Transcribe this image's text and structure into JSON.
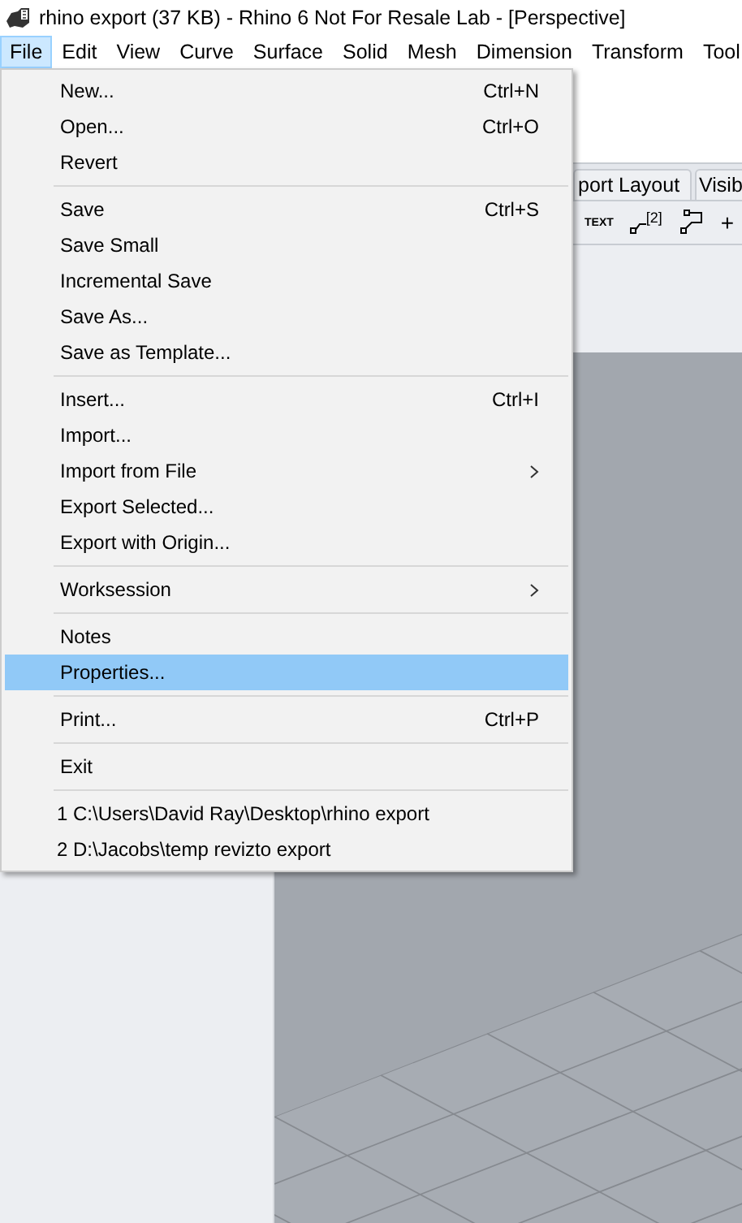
{
  "window": {
    "title": "rhino export (37 KB) - Rhino 6 Not For Resale Lab - [Perspective]"
  },
  "menubar": [
    {
      "label": "File",
      "selected": true
    },
    {
      "label": "Edit",
      "selected": false
    },
    {
      "label": "View",
      "selected": false
    },
    {
      "label": "Curve",
      "selected": false
    },
    {
      "label": "Surface",
      "selected": false
    },
    {
      "label": "Solid",
      "selected": false
    },
    {
      "label": "Mesh",
      "selected": false
    },
    {
      "label": "Dimension",
      "selected": false
    },
    {
      "label": "Transform",
      "selected": false
    },
    {
      "label": "Tool",
      "selected": false
    }
  ],
  "tabs": [
    {
      "label": "port Layout"
    },
    {
      "label": "Visib"
    }
  ],
  "toolbar": [
    {
      "kind": "text",
      "label": "TEXT"
    },
    {
      "kind": "leader",
      "label": "[2]"
    },
    {
      "kind": "leader2"
    },
    {
      "kind": "plus",
      "label": "+"
    }
  ],
  "file_menu": [
    {
      "kind": "item",
      "label": "New...",
      "shortcut": "Ctrl+N",
      "submenu": false,
      "selected": false
    },
    {
      "kind": "item",
      "label": "Open...",
      "shortcut": "Ctrl+O",
      "submenu": false,
      "selected": false
    },
    {
      "kind": "item",
      "label": "Revert",
      "submenu": false,
      "selected": false
    },
    {
      "kind": "separator"
    },
    {
      "kind": "item",
      "label": "Save",
      "shortcut": "Ctrl+S",
      "submenu": false,
      "selected": false
    },
    {
      "kind": "item",
      "label": "Save Small",
      "submenu": false,
      "selected": false
    },
    {
      "kind": "item",
      "label": "Incremental Save",
      "submenu": false,
      "selected": false
    },
    {
      "kind": "item",
      "label": "Save As...",
      "submenu": false,
      "selected": false
    },
    {
      "kind": "item",
      "label": "Save as Template...",
      "submenu": false,
      "selected": false
    },
    {
      "kind": "separator"
    },
    {
      "kind": "item",
      "label": "Insert...",
      "shortcut": "Ctrl+I",
      "submenu": false,
      "selected": false
    },
    {
      "kind": "item",
      "label": "Import...",
      "submenu": false,
      "selected": false
    },
    {
      "kind": "item",
      "label": "Import from File",
      "submenu": true,
      "selected": false
    },
    {
      "kind": "item",
      "label": "Export Selected...",
      "submenu": false,
      "selected": false
    },
    {
      "kind": "item",
      "label": "Export with Origin...",
      "submenu": false,
      "selected": false
    },
    {
      "kind": "separator"
    },
    {
      "kind": "item",
      "label": "Worksession",
      "submenu": true,
      "selected": false
    },
    {
      "kind": "separator"
    },
    {
      "kind": "item",
      "label": "Notes",
      "submenu": false,
      "selected": false
    },
    {
      "kind": "item",
      "label": "Properties...",
      "submenu": false,
      "selected": true
    },
    {
      "kind": "separator"
    },
    {
      "kind": "item",
      "label": "Print...",
      "shortcut": "Ctrl+P",
      "submenu": false,
      "selected": false
    },
    {
      "kind": "separator"
    },
    {
      "kind": "item",
      "label": "Exit",
      "submenu": false,
      "selected": false
    },
    {
      "kind": "separator"
    },
    {
      "kind": "recent",
      "label": "1 C:\\Users\\David Ray\\Desktop\\rhino export",
      "selected": false
    },
    {
      "kind": "recent",
      "label": "2 D:\\Jacobs\\temp revizto export",
      "selected": false
    }
  ]
}
